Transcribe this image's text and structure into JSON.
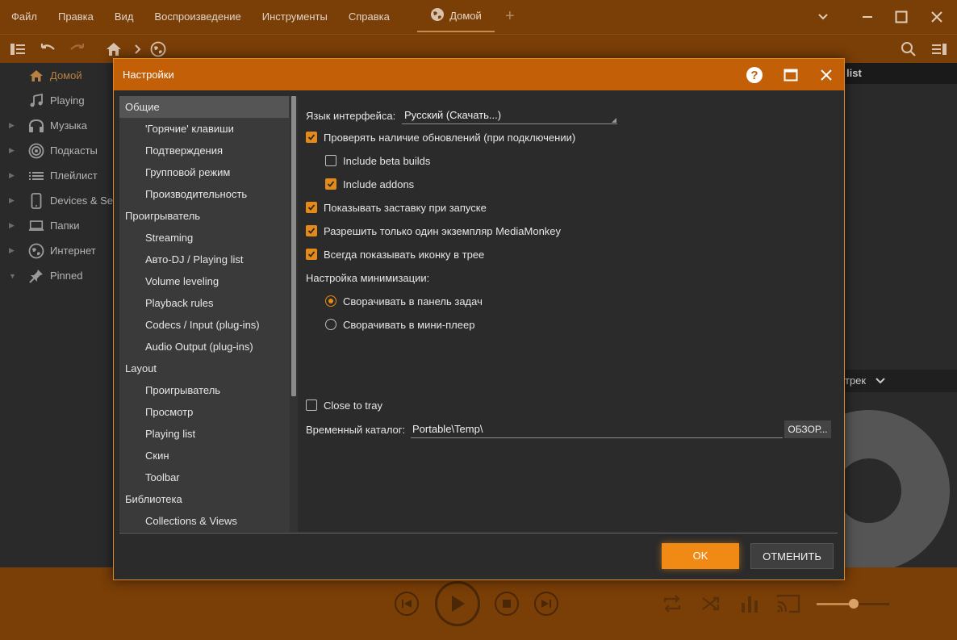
{
  "app": {
    "menu": [
      "Файл",
      "Правка",
      "Вид",
      "Воспроизведение",
      "Инструменты",
      "Справка"
    ],
    "tab_label": "Домой",
    "sidebar": [
      {
        "label": "Домой",
        "icon": "home-icon",
        "active": true,
        "arrow": ""
      },
      {
        "label": "Playing",
        "icon": "music-note-icon",
        "active": false,
        "arrow": ""
      },
      {
        "label": "Музыка",
        "icon": "headphones-icon",
        "active": false,
        "arrow": "▶"
      },
      {
        "label": "Подкасты",
        "icon": "podcast-icon",
        "active": false,
        "arrow": "▶"
      },
      {
        "label": "Плейлист",
        "icon": "playlist-icon",
        "active": false,
        "arrow": "▶"
      },
      {
        "label": "Devices & Ser",
        "icon": "phone-icon",
        "active": false,
        "arrow": "▶"
      },
      {
        "label": "Папки",
        "icon": "laptop-icon",
        "active": false,
        "arrow": "▶"
      },
      {
        "label": "Интернет",
        "icon": "globe-icon",
        "active": false,
        "arrow": "▶"
      },
      {
        "label": "Pinned",
        "icon": "pin-icon",
        "active": false,
        "arrow": "▼"
      }
    ],
    "right_pane": {
      "header1": "list",
      "header2": "трек"
    },
    "accent": "#e58a19",
    "chrome_color": "#7a3e07"
  },
  "dialog": {
    "title": "Настройки",
    "tree": [
      {
        "label": "Общие",
        "level": 0,
        "selected": true
      },
      {
        "label": "'Горячие' клавиши",
        "level": 1
      },
      {
        "label": "Подтверждения",
        "level": 1
      },
      {
        "label": "Групповой режим",
        "level": 1
      },
      {
        "label": "Производительность",
        "level": 1
      },
      {
        "label": "Проигрыватель",
        "level": 0
      },
      {
        "label": "Streaming",
        "level": 1
      },
      {
        "label": "Авто-DJ / Playing list",
        "level": 1
      },
      {
        "label": "Volume leveling",
        "level": 1
      },
      {
        "label": "Playback rules",
        "level": 1
      },
      {
        "label": "Codecs / Input (plug-ins)",
        "level": 1
      },
      {
        "label": "Audio Output (plug-ins)",
        "level": 1
      },
      {
        "label": "Layout",
        "level": 0
      },
      {
        "label": "Проигрыватель",
        "level": 1
      },
      {
        "label": "Просмотр",
        "level": 1
      },
      {
        "label": "Playing list",
        "level": 1
      },
      {
        "label": "Скин",
        "level": 1
      },
      {
        "label": "Toolbar",
        "level": 1
      },
      {
        "label": "Библиотека",
        "level": 0
      },
      {
        "label": "Collections & Views",
        "level": 1
      }
    ],
    "language_label": "Язык интерфейса:",
    "language_value": "Русский (Скачать...)",
    "options": [
      {
        "label": "Проверять наличие обновлений (при подключении)",
        "checked": true,
        "indent": 0
      },
      {
        "label": "Include beta builds",
        "checked": false,
        "indent": 1
      },
      {
        "label": "Include addons",
        "checked": true,
        "indent": 1
      },
      {
        "label": "Показывать заставку при запуске",
        "checked": true,
        "indent": 0
      },
      {
        "label": "Разрешить только один экземпляр MediaMonkey",
        "checked": true,
        "indent": 0
      },
      {
        "label": "Всегда показывать иконку в трее",
        "checked": true,
        "indent": 0
      }
    ],
    "minimize_label": "Настройка минимизации:",
    "minimize_options": [
      {
        "label": "Сворачивать в панель задач",
        "selected": true
      },
      {
        "label": "Сворачивать в мини-плеер",
        "selected": false
      }
    ],
    "close_to_tray": {
      "label": "Close to tray",
      "checked": false
    },
    "temp_label": "Временный каталог:",
    "temp_value": "Portable\\Temp\\",
    "browse_label": "ОБЗОР...",
    "ok_label": "OK",
    "cancel_label": "ОТМЕНИТЬ"
  }
}
